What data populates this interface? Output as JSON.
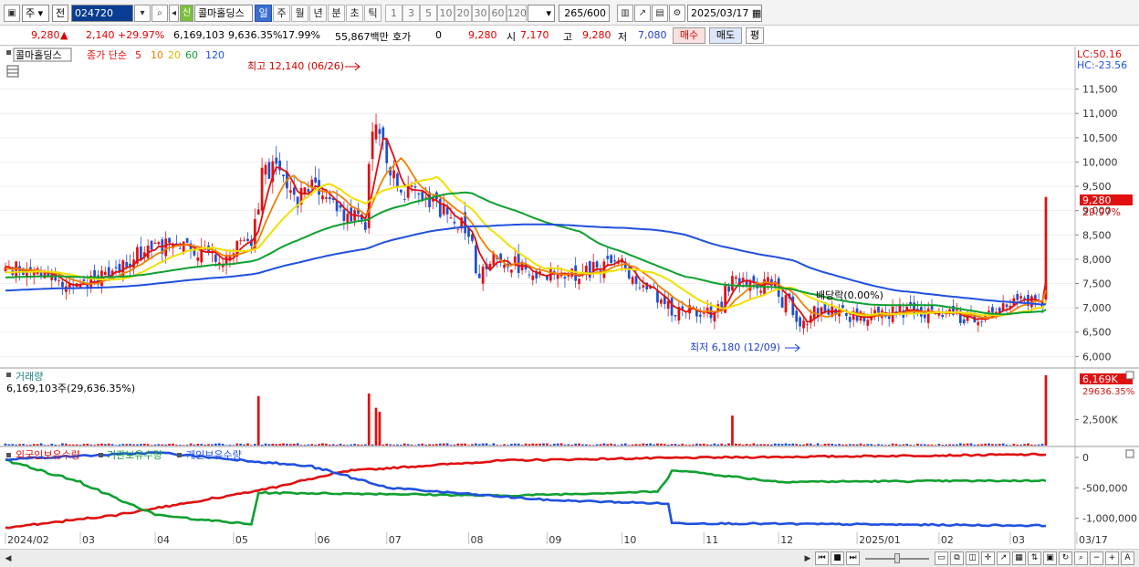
{
  "toolbar": {
    "period_type": "주",
    "prev_label": "전",
    "code_value": "024720",
    "flag_label": "신",
    "stock_name": "콜마홀딩스",
    "period_buttons": [
      {
        "label": "일",
        "active": true
      },
      {
        "label": "주",
        "active": false
      },
      {
        "label": "월",
        "active": false
      },
      {
        "label": "년",
        "active": false
      },
      {
        "label": "분",
        "active": false
      },
      {
        "label": "초",
        "active": false
      },
      {
        "label": "틱",
        "active": false
      }
    ],
    "interval_buttons": [
      "1",
      "3",
      "5",
      "10",
      "20",
      "30",
      "60",
      "120"
    ],
    "count_value": "265",
    "count_total": "/600",
    "date_value": "2025/03/17"
  },
  "info": {
    "price": "9,280",
    "change": "2,140",
    "change_pct": "+29.97%",
    "volume": "6,169,103",
    "volume_ratio": "9,636.35%",
    "turnover": "17.99%",
    "amount": "55,867백만",
    "quote_label": "호가",
    "quote_value": "0",
    "quote_price": "9,280",
    "open_label": "시",
    "open": "7,170",
    "high_label": "고",
    "high": "9,280",
    "low_label": "저",
    "low": "7,080",
    "buy_label": "매수",
    "sell_label": "매도",
    "eval_label": "평"
  },
  "chart": {
    "price_legend": {
      "name": "콜마홀딩스",
      "label": "종가 단순",
      "ma": [
        {
          "period": "5",
          "color": "#e01010"
        },
        {
          "period": "10",
          "color": "#f08000"
        },
        {
          "period": "20",
          "color": "#f0e000"
        },
        {
          "period": "60",
          "color": "#10a030"
        },
        {
          "period": "120",
          "color": "#2050e0"
        }
      ]
    },
    "lc_label": "LC:50.16",
    "hc_label": "HC:-23.56",
    "high_annotation": "최고 12,140 (06/26)",
    "low_annotation": "최저 6,180 (12/09)",
    "event_annotation": "배당락(0.00%)",
    "current_price_tag": "9,280",
    "current_pct_tag": "29.97%",
    "volume_title": "거래량",
    "volume_info": "6,169,103주(29,636.35%)",
    "volume_tag": "6,169K",
    "volume_pct_tag": "29636.35%",
    "holdings_legend": [
      "외국인보유수량",
      "기관보유수량",
      "개인보유수량"
    ],
    "holdings_colors": [
      "#e01010",
      "#10a030",
      "#2050e0"
    ],
    "up_color": "#e01010",
    "down_color": "#1f4fd0"
  },
  "chart_data": {
    "type": "candlestick",
    "price_axis": [
      "11,500",
      "11,000",
      "10,500",
      "10,000",
      "9,500",
      "9,000",
      "8,500",
      "8,000",
      "7,500",
      "7,000",
      "6,500",
      "6,000"
    ],
    "price_ylim": [
      5800,
      12300
    ],
    "volume_axis": [
      "2,500K"
    ],
    "holdings_axis": [
      "0",
      "-500,000",
      "-1,000,000"
    ],
    "x_labels": [
      "2024/02",
      "03",
      "04",
      "05",
      "06",
      "07",
      "08",
      "09",
      "10",
      "11",
      "12",
      "2025/01",
      "02",
      "03",
      "03/17"
    ],
    "price_anchors": [
      [
        "2024-02-01",
        7900
      ],
      [
        "2024-02-15",
        7700
      ],
      [
        "2024-03-01",
        7450
      ],
      [
        "2024-03-15",
        7800
      ],
      [
        "2024-04-01",
        8300
      ],
      [
        "2024-04-15",
        8250
      ],
      [
        "2024-04-25",
        7900
      ],
      [
        "2024-05-01",
        8200
      ],
      [
        "2024-05-08",
        8350
      ],
      [
        "2024-05-10",
        9000
      ],
      [
        "2024-05-14",
        9900
      ],
      [
        "2024-05-20",
        9700
      ],
      [
        "2024-05-27",
        9250
      ],
      [
        "2024-06-03",
        9600
      ],
      [
        "2024-06-10",
        9050
      ],
      [
        "2024-06-17",
        8900
      ],
      [
        "2024-06-21",
        8750
      ],
      [
        "2024-06-24",
        10100
      ],
      [
        "2024-06-26",
        10800
      ],
      [
        "2024-07-01",
        10000
      ],
      [
        "2024-07-05",
        9400
      ],
      [
        "2024-07-15",
        9300
      ],
      [
        "2024-07-25",
        8900
      ],
      [
        "2024-08-01",
        8600
      ],
      [
        "2024-08-05",
        7600
      ],
      [
        "2024-08-12",
        8000
      ],
      [
        "2024-08-20",
        7900
      ],
      [
        "2024-09-01",
        7650
      ],
      [
        "2024-09-15",
        7700
      ],
      [
        "2024-09-25",
        7900
      ],
      [
        "2024-10-01",
        7850
      ],
      [
        "2024-10-10",
        7400
      ],
      [
        "2024-10-20",
        7000
      ],
      [
        "2024-11-01",
        6850
      ],
      [
        "2024-11-08",
        7000
      ],
      [
        "2024-11-14",
        7600
      ],
      [
        "2024-11-20",
        7550
      ],
      [
        "2024-11-28",
        7450
      ],
      [
        "2024-12-05",
        7050
      ],
      [
        "2024-12-09",
        6700
      ],
      [
        "2024-12-16",
        6950
      ],
      [
        "2024-12-30",
        6850
      ],
      [
        "2025-01-10",
        6900
      ],
      [
        "2025-01-20",
        6950
      ],
      [
        "2025-02-01",
        6850
      ],
      [
        "2025-02-15",
        6800
      ],
      [
        "2025-02-25",
        6950
      ],
      [
        "2025-03-05",
        7150
      ],
      [
        "2025-03-14",
        7140
      ],
      [
        "2025-03-17",
        9280
      ]
    ],
    "ma_start": {
      "5": 7850,
      "10": 7800,
      "20": 7720,
      "60": 7620,
      "120": 7350
    },
    "volume_spikes": [
      [
        "2024-05-10",
        1.9
      ],
      [
        "2024-06-24",
        2.0
      ],
      [
        "2024-06-26",
        1.45
      ],
      [
        "2024-06-27",
        1.3
      ],
      [
        "2024-11-13",
        1.15
      ],
      [
        "2025-03-17",
        2.7
      ]
    ],
    "holdings": {
      "foreign": [
        [
          "2024-02-01",
          -1160000
        ],
        [
          "2024-03-15",
          -950000
        ],
        [
          "2024-05-10",
          -550000
        ],
        [
          "2024-06-15",
          -220000
        ],
        [
          "2024-08-15",
          -50000
        ],
        [
          "2024-10-15",
          -10000
        ],
        [
          "2025-03-17",
          50000
        ]
      ],
      "institution": [
        [
          "2024-02-01",
          -40000
        ],
        [
          "2024-03-01",
          -400000
        ],
        [
          "2024-04-01",
          -950000
        ],
        [
          "2024-05-08",
          -1100000
        ],
        [
          "2024-05-10",
          -580000
        ],
        [
          "2024-07-01",
          -600000
        ],
        [
          "2024-08-15",
          -630000
        ],
        [
          "2024-10-15",
          -560000
        ],
        [
          "2024-10-20",
          -200000
        ],
        [
          "2024-12-01",
          -400000
        ],
        [
          "2025-03-17",
          -380000
        ]
      ],
      "individual": [
        [
          "2024-02-01",
          -30000
        ],
        [
          "2024-04-01",
          80000
        ],
        [
          "2024-06-01",
          -150000
        ],
        [
          "2024-07-01",
          -500000
        ],
        [
          "2024-09-01",
          -700000
        ],
        [
          "2024-10-20",
          -760000
        ],
        [
          "2024-10-21",
          -1080000
        ],
        [
          "2025-03-17",
          -1120000
        ]
      ]
    }
  }
}
